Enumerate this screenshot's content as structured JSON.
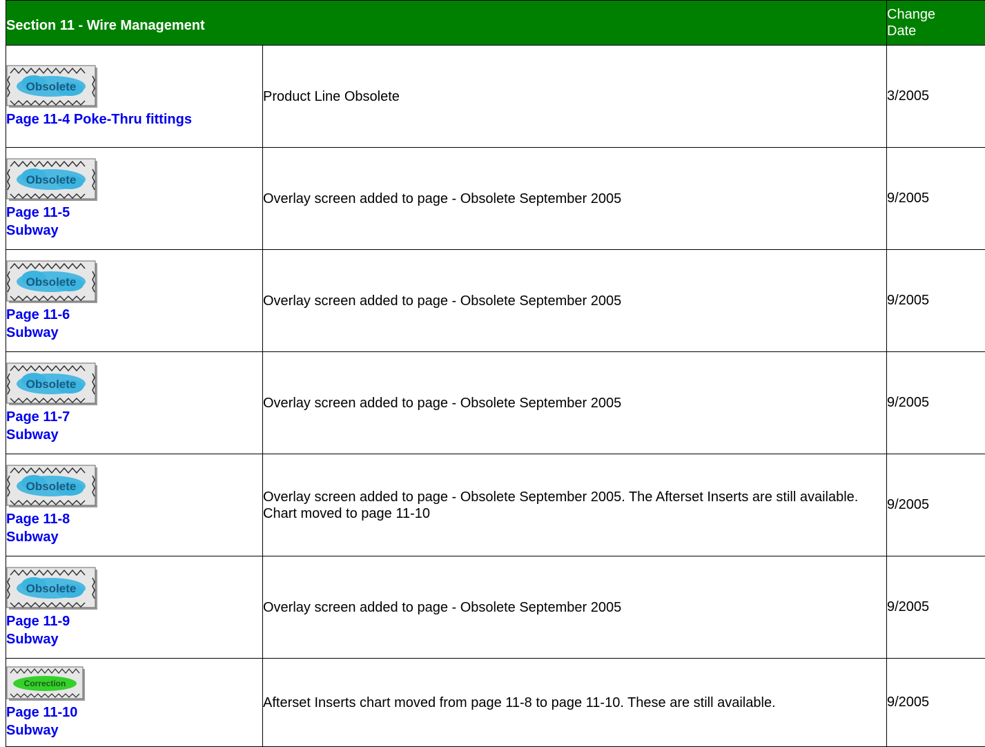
{
  "header": {
    "section_title": "Section 11 - Wire Management",
    "date_header_line1": "Change",
    "date_header_line2": "Date"
  },
  "colors": {
    "header_bg": "#008000",
    "link": "#0000ee",
    "obsolete_stamp": "#3bb4e0",
    "correction_stamp": "#35d02c"
  },
  "rows": [
    {
      "stamp": "obsolete",
      "stamp_label": "Obsolete",
      "page_line1": "Page 11-4 Poke-Thru fittings",
      "page_line2": "",
      "description": "Product Line Obsolete",
      "date": "3/2005"
    },
    {
      "stamp": "obsolete",
      "stamp_label": "Obsolete",
      "page_line1": "Page 11-5",
      "page_line2": "Subway",
      "description": "Overlay screen added to page  - Obsolete September 2005",
      "date": "9/2005"
    },
    {
      "stamp": "obsolete",
      "stamp_label": "Obsolete",
      "page_line1": "Page 11-6",
      "page_line2": "Subway",
      "description": "Overlay screen added to page  - Obsolete September 2005",
      "date": "9/2005"
    },
    {
      "stamp": "obsolete",
      "stamp_label": "Obsolete",
      "page_line1": "Page 11-7",
      "page_line2": "Subway",
      "description": "Overlay screen added to page  - Obsolete September 2005",
      "date": "9/2005"
    },
    {
      "stamp": "obsolete",
      "stamp_label": "Obsolete",
      "page_line1": "Page 11-8",
      "page_line2": "Subway",
      "description": "Overlay screen added to page - Obsolete September 2005. The Afterset Inserts are still available. Chart moved to page 11-10",
      "date": "9/2005"
    },
    {
      "stamp": "obsolete",
      "stamp_label": "Obsolete",
      "page_line1": "Page 11-9",
      "page_line2": "Subway",
      "description": "Overlay screen added to page  - Obsolete September 2005",
      "date": "9/2005"
    },
    {
      "stamp": "correction",
      "stamp_label": "Correction",
      "page_line1": "Page 11-10",
      "page_line2": "Subway",
      "description": "Afterset Inserts chart moved from page 11-8 to page 11-10.  These are still available.",
      "date": "9/2005"
    }
  ]
}
